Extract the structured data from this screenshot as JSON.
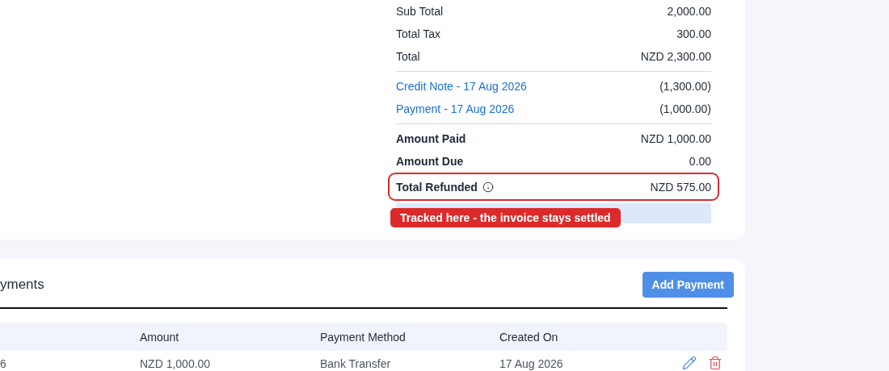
{
  "summary": {
    "rows": [
      {
        "kind": "plain",
        "label": "Sub Total",
        "value": "2,000.00"
      },
      {
        "kind": "plain",
        "label": "Total Tax",
        "value": "300.00"
      },
      {
        "kind": "plain",
        "label": "Total",
        "value": "NZD 2,300.00"
      },
      {
        "kind": "divider"
      },
      {
        "kind": "link",
        "label": "Credit Note - 17 Aug 2026",
        "value": "(1,300.00)"
      },
      {
        "kind": "link",
        "label": "Payment - 17 Aug 2026",
        "value": "(1,000.00)"
      },
      {
        "kind": "divider"
      },
      {
        "kind": "bold",
        "label": "Amount Paid",
        "value": "NZD 1,000.00"
      },
      {
        "kind": "bold",
        "label": "Amount Due",
        "value": "0.00"
      },
      {
        "kind": "highlight",
        "label": "Total Refunded",
        "value": "NZD 575.00",
        "info": true
      }
    ],
    "callout": "Tracked here - the invoice stays settled"
  },
  "payments": {
    "heading": "yments",
    "add_button": "Add Payment",
    "columns": [
      "Amount",
      "Payment Method",
      "Created On"
    ],
    "rows": [
      {
        "column_1": "6",
        "amount": "NZD 1,000.00",
        "method": "Bank Transfer",
        "created": "17 Aug 2026"
      }
    ]
  }
}
